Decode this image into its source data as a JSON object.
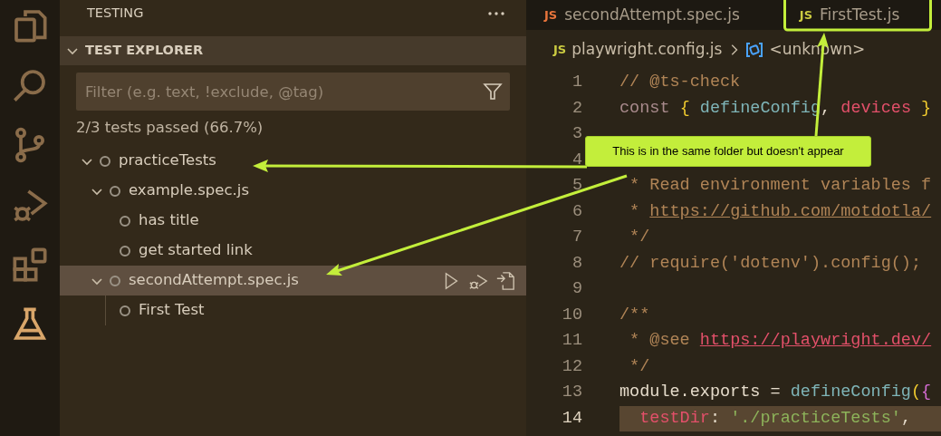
{
  "activity_bar": {
    "items": [
      {
        "kind": "files",
        "selected": false
      },
      {
        "kind": "search",
        "selected": false
      },
      {
        "kind": "source-control",
        "selected": false
      },
      {
        "kind": "run-debug",
        "selected": false
      },
      {
        "kind": "extensions",
        "selected": false
      },
      {
        "kind": "testing",
        "selected": true
      }
    ]
  },
  "sidebar": {
    "title": "TESTING",
    "section": {
      "title": "TEST EXPLORER",
      "expanded": true
    },
    "filter": {
      "placeholder": "Filter (e.g. text, !exclude, @tag)"
    },
    "summary": "2/3 tests passed (66.7%)",
    "tree": [
      {
        "label": "practiceTests",
        "expanded": true,
        "selected": false,
        "children": [
          {
            "label": "example.spec.js",
            "expanded": true,
            "selected": false,
            "children": [
              {
                "label": "has title",
                "selected": false
              },
              {
                "label": "get started link",
                "selected": false
              }
            ]
          },
          {
            "label": "secondAttempt.spec.js",
            "expanded": true,
            "selected": true,
            "children": [
              {
                "label": "First Test",
                "selected": false
              }
            ]
          }
        ]
      }
    ]
  },
  "editor": {
    "tabs": [
      {
        "badge": "JS",
        "label": "secondAttempt.spec.js",
        "color": "#e8743b",
        "selected": false
      },
      {
        "badge": "JS",
        "label": "FirstTest.js",
        "color": "#cbcb41",
        "selected": false
      }
    ],
    "breadcrumb": {
      "badge": "JS",
      "file": "playwright.config.js",
      "symbol": "<unknown>"
    },
    "lines": [
      {
        "number": "1",
        "current": false,
        "tokens": [
          {
            "kind": "comment",
            "text": "// @ts-check"
          }
        ]
      },
      {
        "number": "2",
        "current": false,
        "tokens": [
          {
            "kind": "keyword",
            "text": "const "
          },
          {
            "kind": "brace",
            "text": "{"
          },
          {
            "kind": "function",
            "text": " defineConfig"
          },
          {
            "kind": "plain",
            "text": ", "
          },
          {
            "kind": "variable",
            "text": "devices"
          },
          {
            "kind": "brace",
            "text": " }"
          }
        ]
      },
      {
        "number": "3",
        "current": false
      },
      {
        "number": "4",
        "current": false
      },
      {
        "number": "5",
        "current": false,
        "tokens": [
          {
            "kind": "comment",
            "text": " * Read environment variables f"
          }
        ]
      },
      {
        "number": "6",
        "current": false,
        "tokens": [
          {
            "kind": "comment",
            "text": " * "
          },
          {
            "kind": "comment-link",
            "text": "https://github.com/motdotla/"
          }
        ]
      },
      {
        "number": "7",
        "current": false,
        "tokens": [
          {
            "kind": "comment",
            "text": " */"
          }
        ]
      },
      {
        "number": "8",
        "current": false,
        "tokens": [
          {
            "kind": "comment",
            "text": "// require('dotenv').config();"
          }
        ]
      },
      {
        "number": "9",
        "current": false
      },
      {
        "number": "10",
        "current": false,
        "tokens": [
          {
            "kind": "comment",
            "text": "/**"
          }
        ]
      },
      {
        "number": "11",
        "current": false,
        "tokens": [
          {
            "kind": "comment",
            "text": " * @see "
          },
          {
            "kind": "link",
            "text": "https://playwright.dev/"
          }
        ]
      },
      {
        "number": "12",
        "current": false,
        "tokens": [
          {
            "kind": "comment",
            "text": " */"
          }
        ]
      },
      {
        "number": "13",
        "current": false,
        "tokens": [
          {
            "kind": "plain",
            "text": "module.exports = "
          },
          {
            "kind": "function",
            "text": "defineConfig"
          },
          {
            "kind": "brace",
            "text": "("
          },
          {
            "kind": "brace2",
            "text": "{"
          }
        ]
      },
      {
        "number": "14",
        "current": true,
        "tokens": [
          {
            "kind": "variable",
            "text": "  testDir"
          },
          {
            "kind": "plain",
            "text": ": "
          },
          {
            "kind": "string",
            "text": "'./practiceTests'"
          },
          {
            "kind": "plain",
            "text": ","
          }
        ]
      }
    ]
  },
  "annotation": {
    "callout": "This is in the same folder but doesn't appear"
  }
}
